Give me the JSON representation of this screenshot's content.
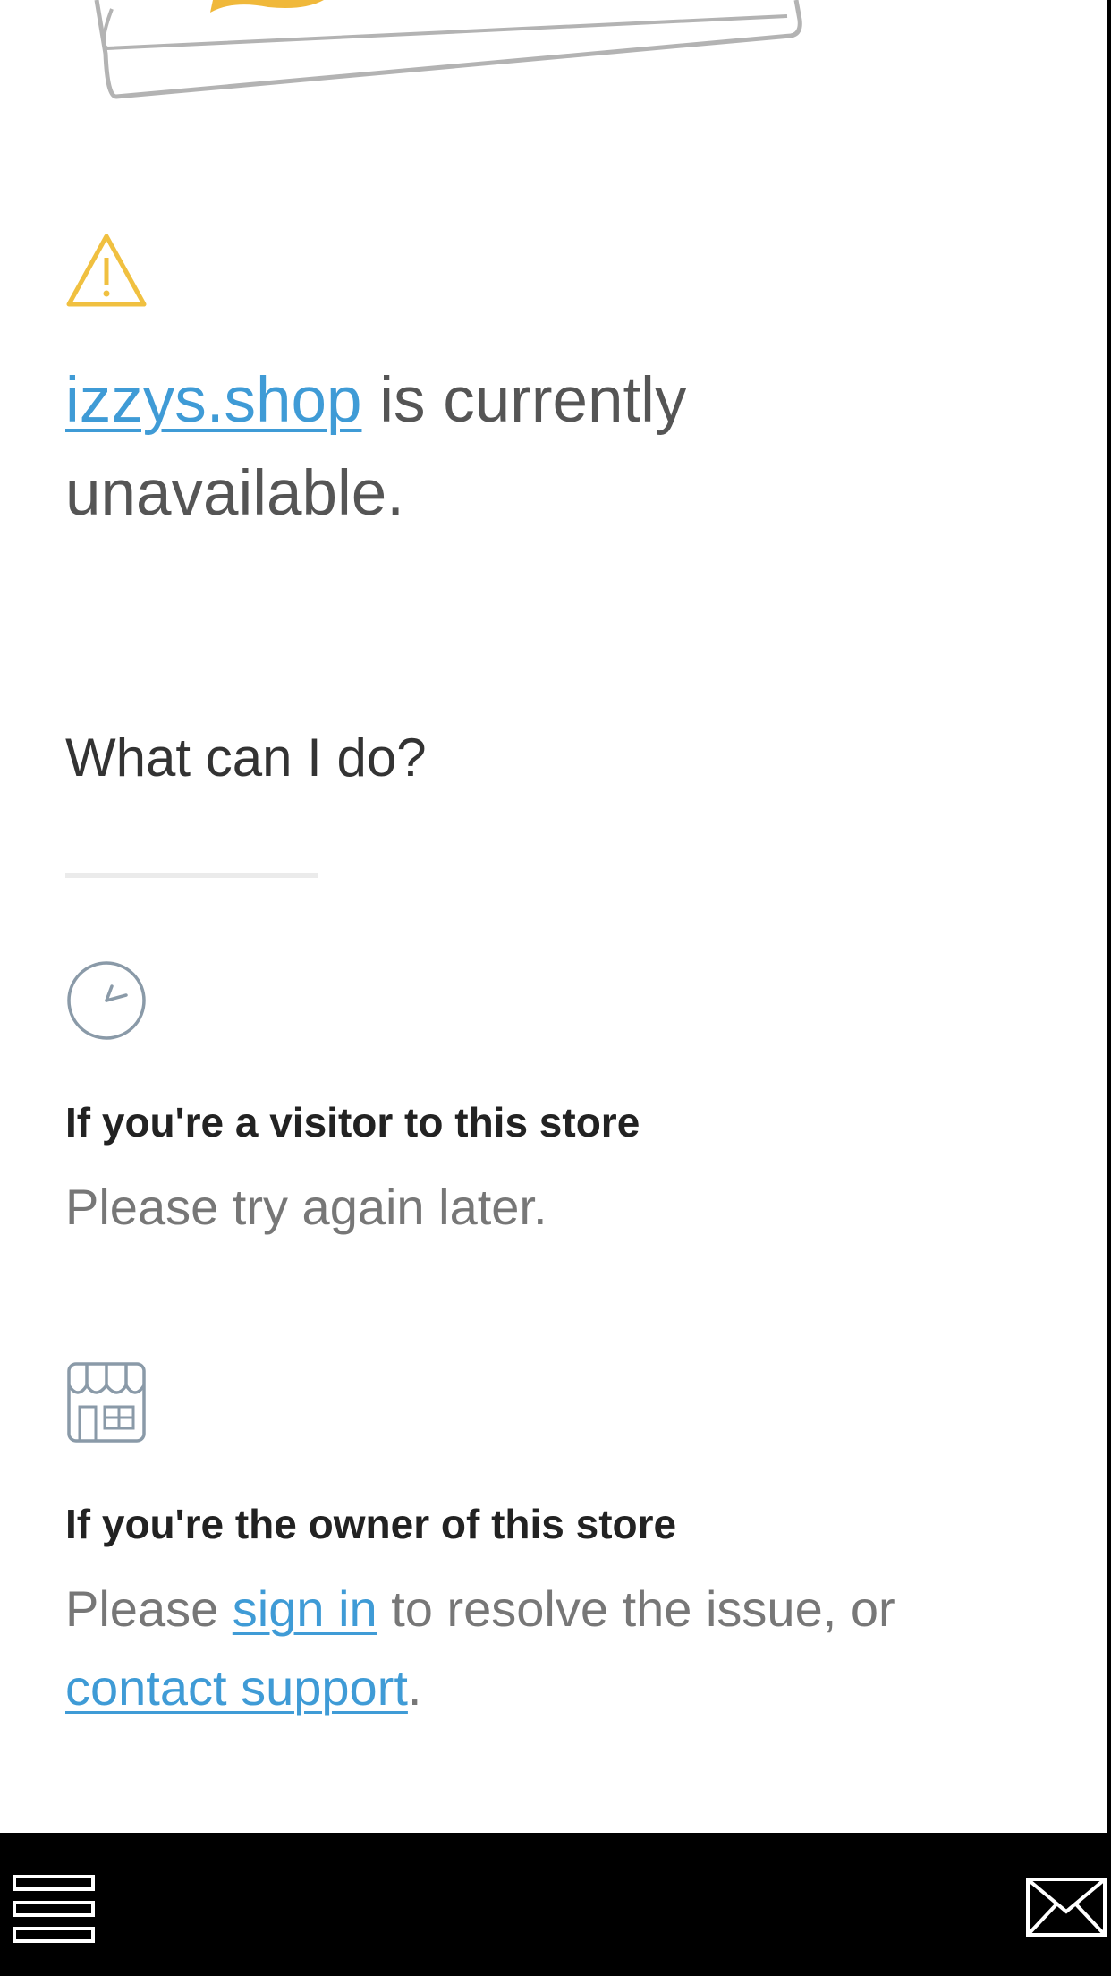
{
  "header": {
    "illustration_icon": "storefront-card-illustration"
  },
  "notice": {
    "icon": "warning-icon",
    "domain_link": "izzys.shop",
    "message_suffix": " is currently unavailable."
  },
  "help": {
    "title": "What can I do?",
    "visitor": {
      "icon": "clock-icon",
      "title": "If you're a visitor to this store",
      "text": "Please try again later."
    },
    "owner": {
      "icon": "store-icon",
      "title": "If you're the owner of this store",
      "text_prefix": "Please ",
      "sign_in_link": "sign in",
      "text_middle": " to resolve the issue, or ",
      "contact_link": "contact support",
      "text_suffix": "."
    }
  },
  "bottom_bar": {
    "menu_icon": "hamburger-menu-icon",
    "mail_icon": "envelope-icon"
  },
  "colors": {
    "link": "#3f9bd6",
    "warning": "#f0c040",
    "icon_gray": "#8a9aa8",
    "bar": "#000000"
  }
}
